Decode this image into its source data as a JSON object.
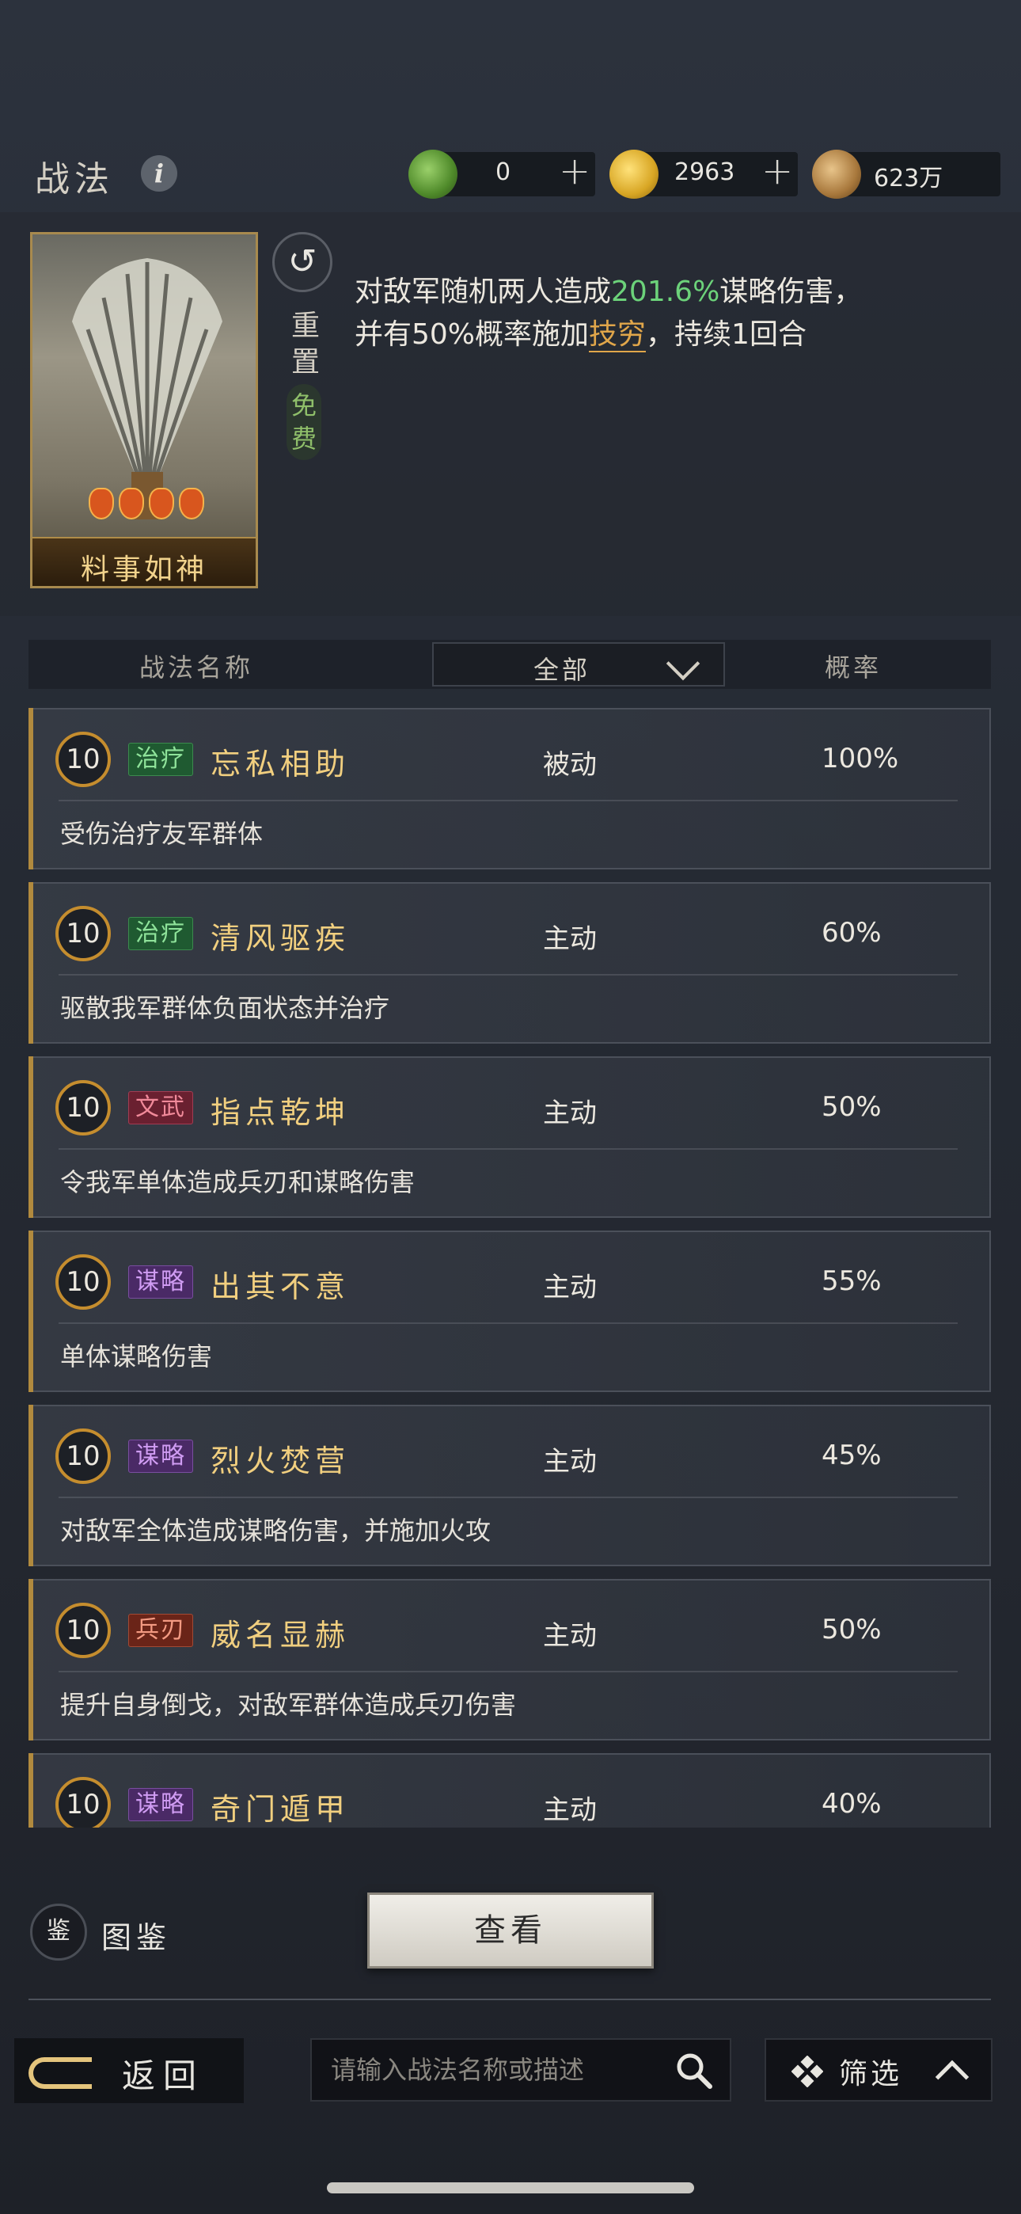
{
  "header": {
    "title": "战法",
    "info_icon": "i"
  },
  "resources": [
    {
      "icon": "jade-icon",
      "value": "0",
      "has_plus": true,
      "plus": "+"
    },
    {
      "icon": "gold-icon",
      "value": "2963",
      "has_plus": true,
      "plus": "+"
    },
    {
      "icon": "copper-icon",
      "value": "623万",
      "has_plus": false
    }
  ],
  "selected_skill": {
    "name": "料事如神",
    "stars": 4,
    "reset_label": "重置",
    "free_label": "免费",
    "desc_prefix": "对敌军随机两人造成",
    "desc_percent": "201.6%",
    "desc_middle": "谋略伤害，",
    "desc_line2_prefix": "并有50%概率施加",
    "desc_status": "技穷",
    "desc_line2_suffix": "，持续1回合"
  },
  "list_header": {
    "name_col": "战法名称",
    "filter_value": "全部",
    "rate_col": "概率"
  },
  "skills": [
    {
      "level": "10",
      "tag": "治疗",
      "tag_type": "heal",
      "name": "忘私相助",
      "type": "被动",
      "rate": "100%",
      "desc": "受伤治疗友军群体"
    },
    {
      "level": "10",
      "tag": "治疗",
      "tag_type": "heal",
      "name": "清风驱疾",
      "type": "主动",
      "rate": "60%",
      "desc": "驱散我军群体负面状态并治疗"
    },
    {
      "level": "10",
      "tag": "文武",
      "tag_type": "wenwu",
      "name": "指点乾坤",
      "type": "主动",
      "rate": "50%",
      "desc": "令我军单体造成兵刃和谋略伤害"
    },
    {
      "level": "10",
      "tag": "谋略",
      "tag_type": "strategy",
      "name": "出其不意",
      "type": "主动",
      "rate": "55%",
      "desc": "单体谋略伤害"
    },
    {
      "level": "10",
      "tag": "谋略",
      "tag_type": "strategy",
      "name": "烈火焚营",
      "type": "主动",
      "rate": "45%",
      "desc": "对敌军全体造成谋略伤害，并施加火攻"
    },
    {
      "level": "10",
      "tag": "兵刃",
      "tag_type": "weapon",
      "name": "威名显赫",
      "type": "主动",
      "rate": "50%",
      "desc": "提升自身倒戈，对敌军群体造成兵刃伤害"
    },
    {
      "level": "10",
      "tag": "谋略",
      "tag_type": "strategy",
      "name": "奇门遁甲",
      "type": "主动",
      "rate": "40%",
      "desc": ""
    }
  ],
  "bottom": {
    "atlas_icon_text": "鉴",
    "atlas_label": "图鉴",
    "view_button": "查看",
    "back_label": "返回",
    "search_placeholder": "请输入战法名称或描述",
    "filter_label": "筛选"
  },
  "colors": {
    "accent_gold": "#f1cf7f",
    "percent_green": "#6cd27a",
    "status_orange": "#e0a64a"
  }
}
